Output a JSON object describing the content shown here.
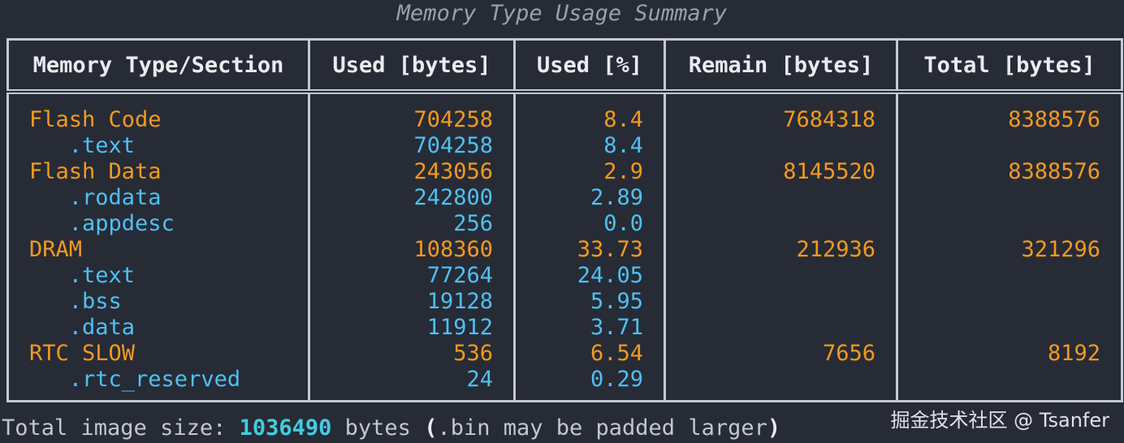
{
  "title": "Memory Type Usage Summary",
  "headers": {
    "type": "Memory Type/Section",
    "used_bytes": "Used [bytes]",
    "used_pct": "Used [%]",
    "remain": "Remain [bytes]",
    "total": "Total [bytes]"
  },
  "rows": [
    {
      "name": "Flash Code",
      "used": "704258",
      "pct": "8.4",
      "remain": "7684318",
      "total": "8388576",
      "kind": "type"
    },
    {
      "name": "   .text",
      "used": "704258",
      "pct": "8.4",
      "remain": "",
      "total": "",
      "kind": "section"
    },
    {
      "name": "Flash Data",
      "used": "243056",
      "pct": "2.9",
      "remain": "8145520",
      "total": "8388576",
      "kind": "type"
    },
    {
      "name": "   .rodata",
      "used": "242800",
      "pct": "2.89",
      "remain": "",
      "total": "",
      "kind": "section"
    },
    {
      "name": "   .appdesc",
      "used": "256",
      "pct": "0.0",
      "remain": "",
      "total": "",
      "kind": "section"
    },
    {
      "name": "DRAM",
      "used": "108360",
      "pct": "33.73",
      "remain": "212936",
      "total": "321296",
      "kind": "type"
    },
    {
      "name": "   .text",
      "used": "77264",
      "pct": "24.05",
      "remain": "",
      "total": "",
      "kind": "section"
    },
    {
      "name": "   .bss",
      "used": "19128",
      "pct": "5.95",
      "remain": "",
      "total": "",
      "kind": "section"
    },
    {
      "name": "   .data",
      "used": "11912",
      "pct": "3.71",
      "remain": "",
      "total": "",
      "kind": "section"
    },
    {
      "name": "RTC SLOW",
      "used": "536",
      "pct": "6.54",
      "remain": "7656",
      "total": "8192",
      "kind": "type"
    },
    {
      "name": "   .rtc_reserved",
      "used": "24",
      "pct": "0.29",
      "remain": "",
      "total": "",
      "kind": "section"
    }
  ],
  "footer": {
    "prefix": "Total image size: ",
    "value": "1036490",
    "middle": " bytes ",
    "open_paren": "(",
    "note": ".bin may be padded larger",
    "close_paren": ")"
  },
  "watermark": "掘金技术社区 @ Tsanfer",
  "colors": {
    "background": "#272b36",
    "type_row": "#f39a1d",
    "section_row": "#4ec1f3",
    "total_value": "#42cde0",
    "border": "#c4c9d0"
  }
}
